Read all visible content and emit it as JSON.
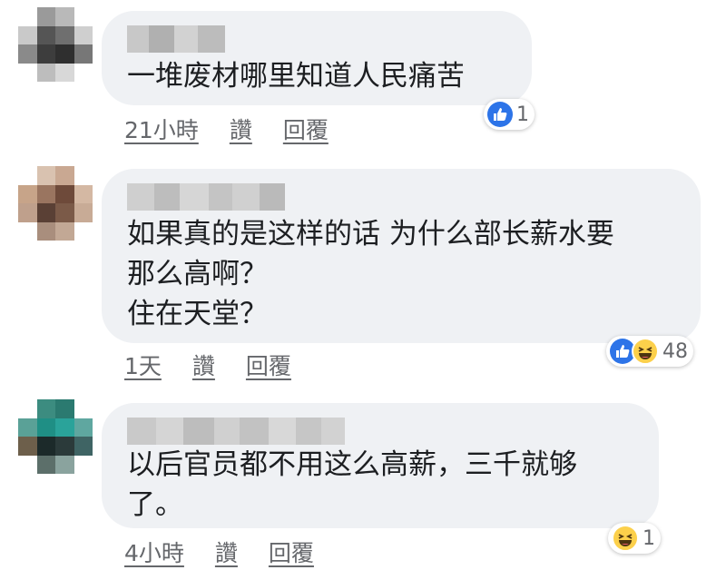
{
  "comments": [
    {
      "text": "一堆废材哪里知道人民痛苦",
      "time": "21小時",
      "like_label": "讚",
      "reply_label": "回覆",
      "reactions": [
        "like"
      ],
      "reaction_count": "1"
    },
    {
      "text": "如果真的是这样的话 为什么部长薪水要\n那么高啊？\n住在天堂？",
      "time": "1天",
      "like_label": "讚",
      "reply_label": "回覆",
      "reactions": [
        "like",
        "haha"
      ],
      "reaction_count": "48"
    },
    {
      "text": "以后官员都不用这么高薪，三千就够\n了。",
      "time": "4小時",
      "like_label": "讚",
      "reply_label": "回覆",
      "reactions": [
        "haha"
      ],
      "reaction_count": "1"
    }
  ],
  "icons": {
    "like": "thumbs-up-icon",
    "haha": "laughing-face-icon"
  },
  "colors": {
    "bubble": "#eff1f4",
    "like_blue": "#2d74e8",
    "haha_yellow": "#fcd04b",
    "meta_gray": "#65676b"
  }
}
